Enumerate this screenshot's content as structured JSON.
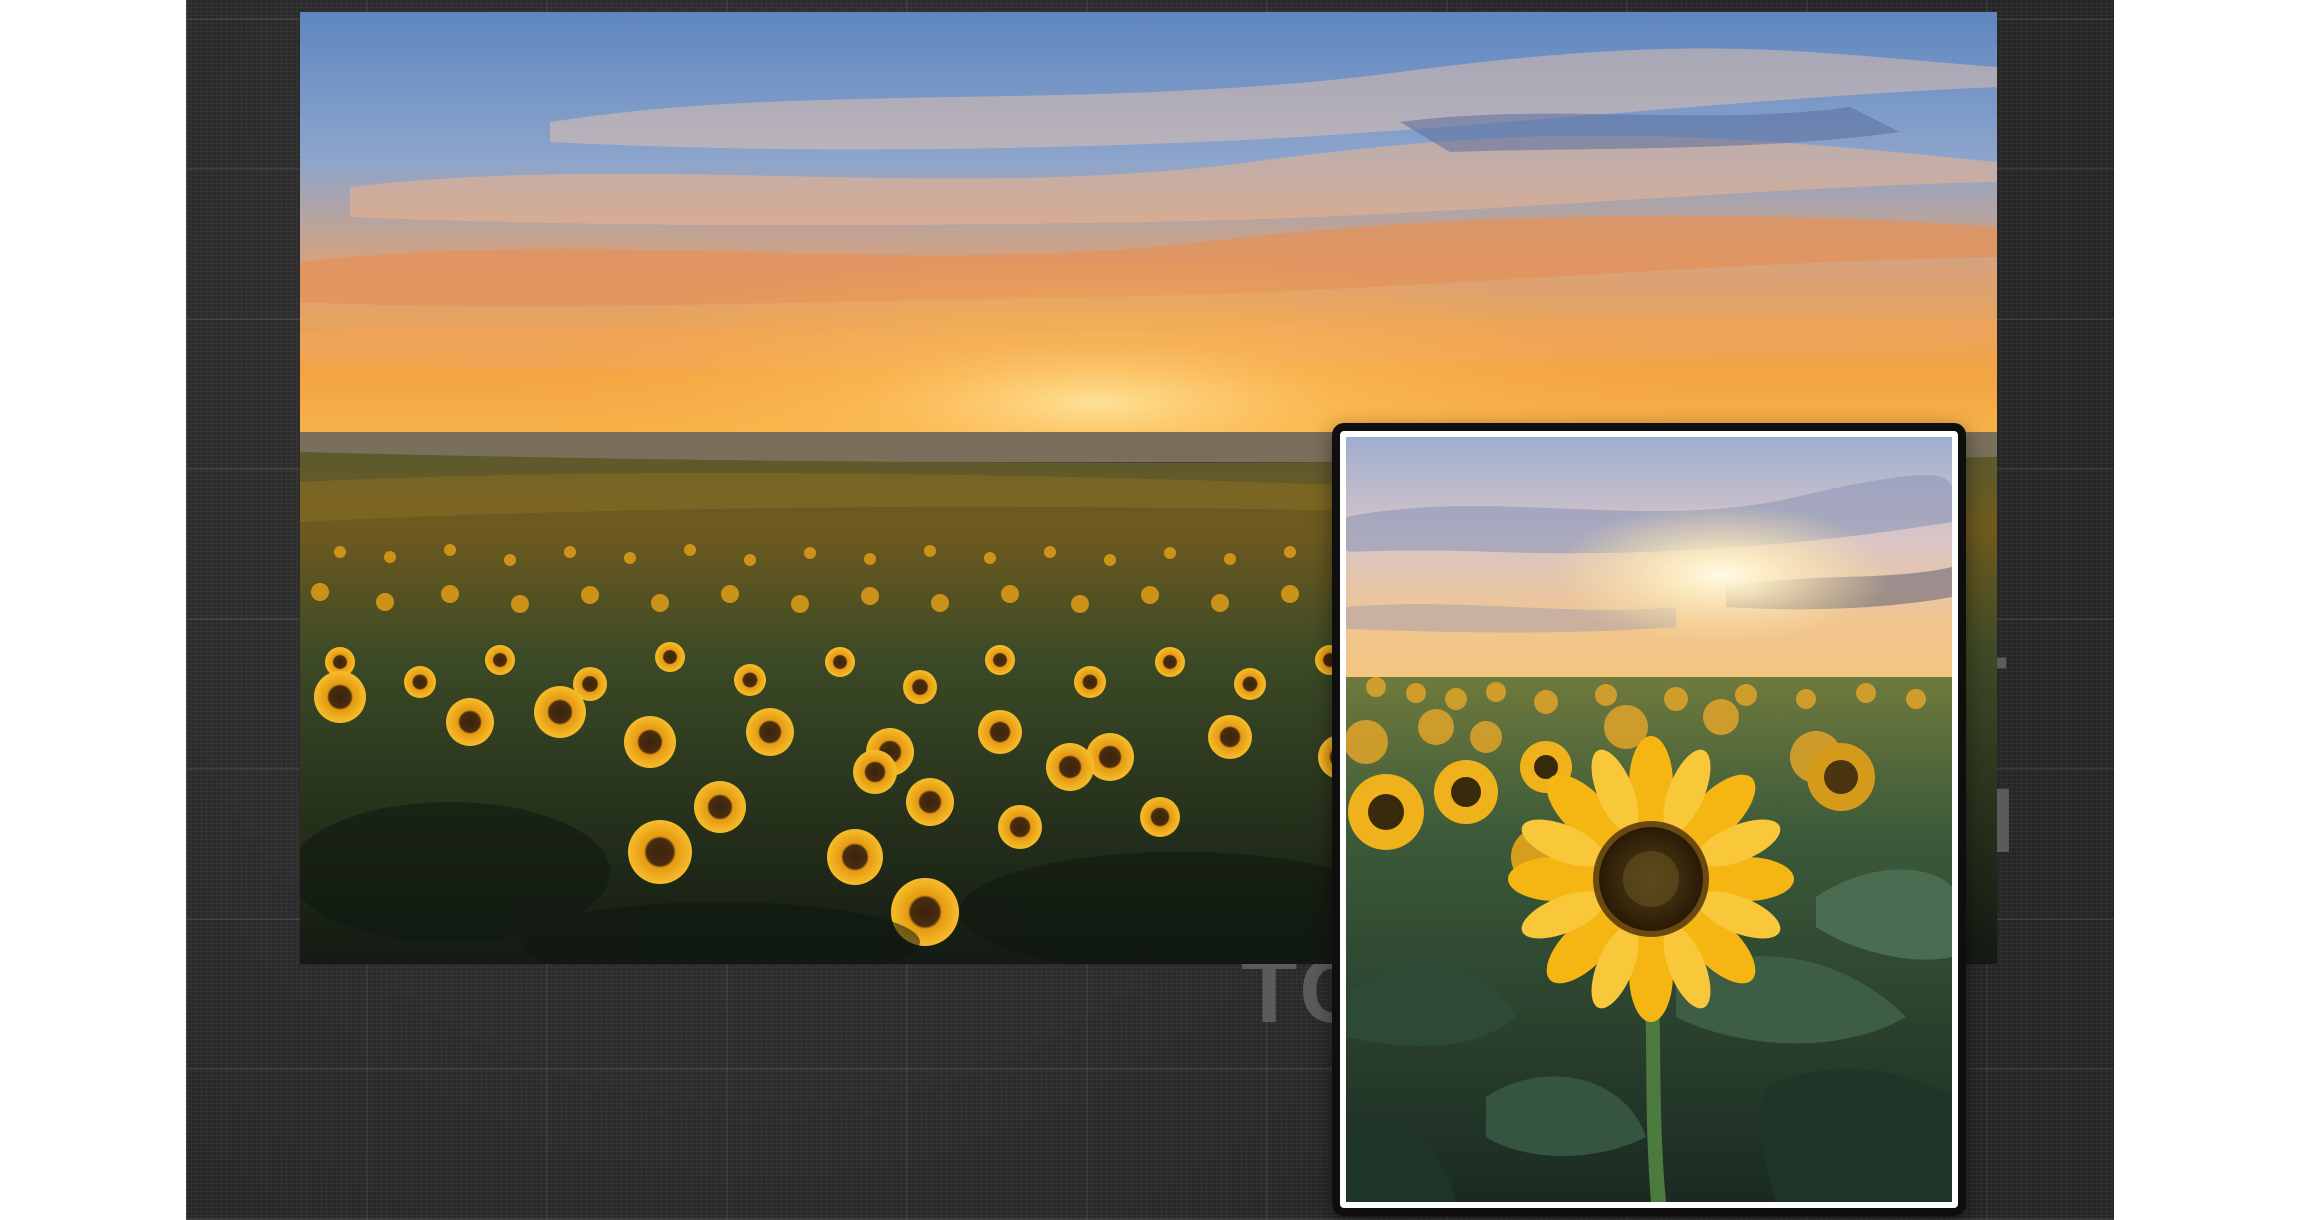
{
  "backdrop": {
    "ghost_text_1": "L-",
    "ghost_text_2": "RI",
    "ghost_text_3": "TC"
  },
  "main_photo": {
    "subject": "sunflower-field-sunset-landscape"
  },
  "inset_photo": {
    "subject": "single-sunflower-closeup"
  },
  "colors": {
    "backdrop": "#2a2a2a",
    "sky_blue": "#6f95c9",
    "sunset_orange": "#f0a347",
    "sunflower_yellow": "#f2b413",
    "foliage_green": "#23392a",
    "frame_white": "#ffffff"
  }
}
